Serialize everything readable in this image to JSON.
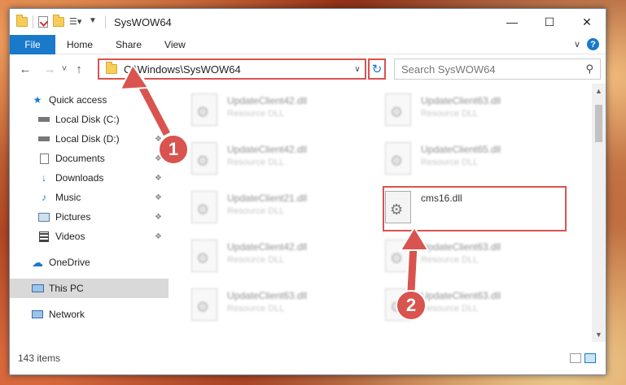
{
  "window": {
    "title": "SysWOW64",
    "controls": {
      "minimize": "—",
      "maximize": "☐",
      "close": "✕"
    }
  },
  "ribbon": {
    "file_label": "File",
    "tabs": [
      "Home",
      "Share",
      "View"
    ]
  },
  "navbar": {
    "back": "←",
    "forward": "→",
    "recent": "˅",
    "up": "↑",
    "address": "C:\\Windows\\SysWOW64",
    "refresh": "↻",
    "search_placeholder": "Search SysWOW64"
  },
  "sidebar": {
    "items": [
      {
        "label": "Quick access",
        "icon": "star-icon"
      },
      {
        "label": "Local Disk (C:)",
        "icon": "drive-icon"
      },
      {
        "label": "Local Disk (D:)",
        "icon": "drive-icon"
      },
      {
        "label": "Documents",
        "icon": "documents-icon"
      },
      {
        "label": "Downloads",
        "icon": "downloads-icon"
      },
      {
        "label": "Music",
        "icon": "music-icon"
      },
      {
        "label": "Pictures",
        "icon": "pictures-icon"
      },
      {
        "label": "Videos",
        "icon": "videos-icon"
      },
      {
        "label": "OneDrive",
        "icon": "cloud-icon"
      },
      {
        "label": "This PC",
        "icon": "computer-icon"
      },
      {
        "label": "Network",
        "icon": "network-icon"
      }
    ]
  },
  "files": [
    {
      "name": "UpdateClient42.dll",
      "desc": "Resource DLL"
    },
    {
      "name": "UpdateClient63.dll",
      "desc": "Resource DLL"
    },
    {
      "name": "UpdateClient42.dll",
      "desc": "Resource DLL"
    },
    {
      "name": "UpdateClient65.dll",
      "desc": "Resource DLL"
    },
    {
      "name": "UpdateClient21.dll",
      "desc": "Resource DLL"
    },
    {
      "name": "cms16.dll",
      "desc": ""
    },
    {
      "name": "UpdateClient42.dll",
      "desc": "Resource DLL"
    },
    {
      "name": "UpdateClient63.dll",
      "desc": "Resource DLL"
    },
    {
      "name": "UpdateClient63.dll",
      "desc": "Resource DLL"
    },
    {
      "name": "UpdateClient63.dll",
      "desc": "Resource DLL"
    }
  ],
  "status": {
    "items_count": "143 items"
  },
  "annotations": {
    "step1": "1",
    "step2": "2",
    "color": "#d9534f"
  }
}
